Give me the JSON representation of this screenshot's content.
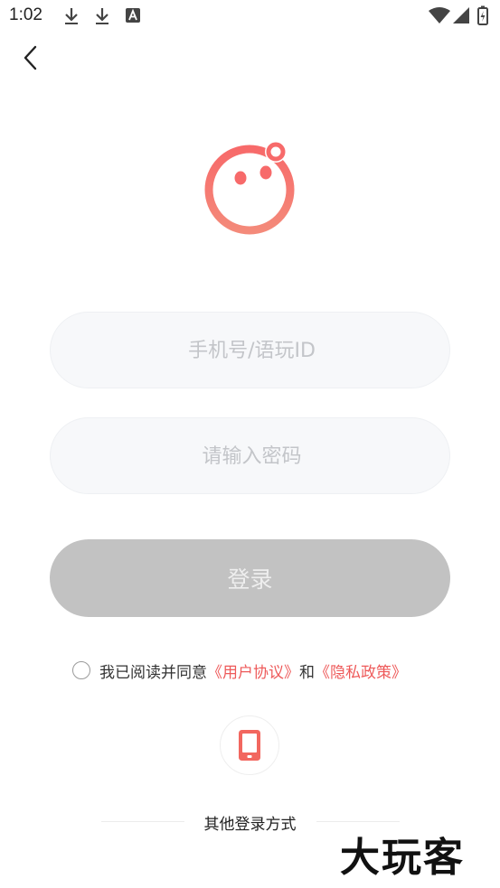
{
  "status_bar": {
    "time": "1:02",
    "icons": [
      "download-icon",
      "download-icon",
      "notification-a-icon",
      "wifi-icon",
      "signal-icon",
      "battery-icon"
    ]
  },
  "nav": {
    "back_icon": "chevron-left-icon"
  },
  "logo": {
    "icon": "smiley-logo",
    "color": "#f26b6b"
  },
  "form": {
    "phone_placeholder": "手机号/语玩ID",
    "password_placeholder": "请输入密码",
    "login_label": "登录"
  },
  "agreement": {
    "prefix": "我已阅读并同意",
    "user_agreement": "《用户协议》",
    "and": "和",
    "privacy_policy": "《隐私政策》"
  },
  "other_login": {
    "phone_icon": "phone-icon",
    "label": "其他登录方式"
  },
  "watermark": "大玩客",
  "colors": {
    "accent": "#f26b6b",
    "link": "#ee5a5a",
    "button_disabled": "#c2c2c2",
    "field_bg": "#f7f8fa"
  }
}
